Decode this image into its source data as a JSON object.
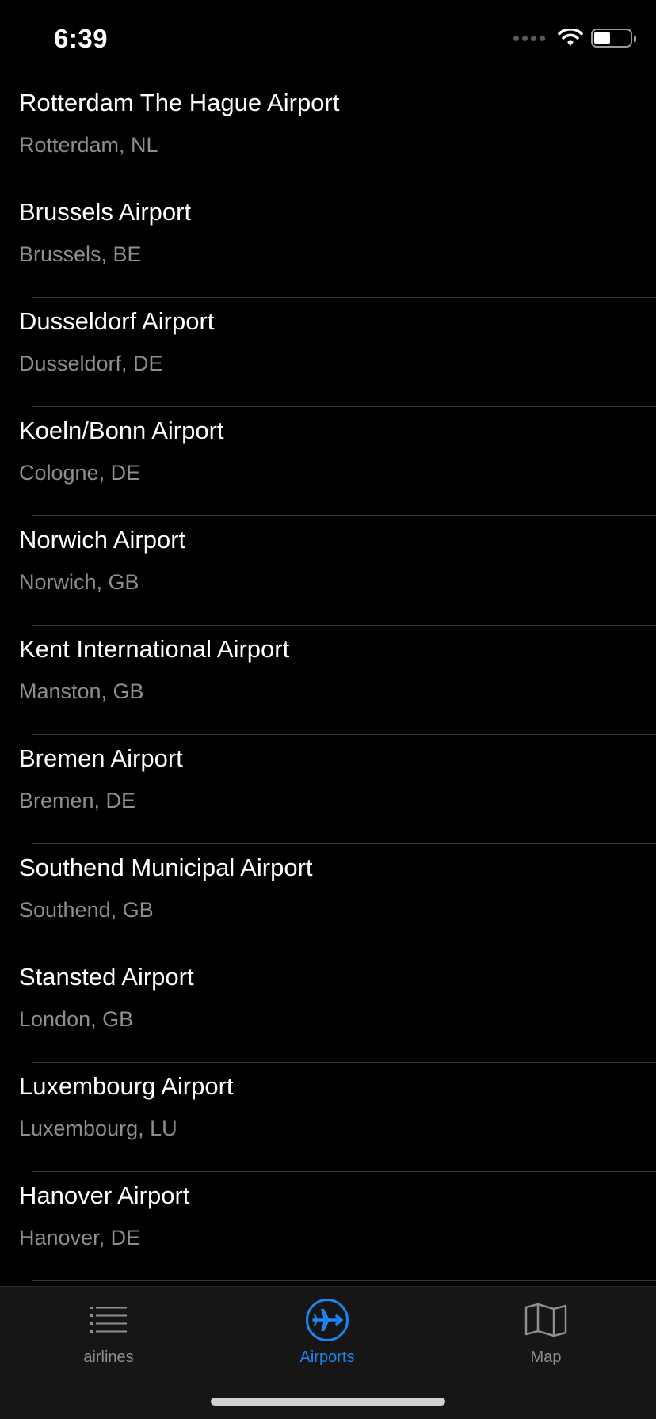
{
  "status": {
    "time": "6:39"
  },
  "airports": [
    {
      "name": "Rotterdam The Hague Airport",
      "location": "Rotterdam, NL"
    },
    {
      "name": "Brussels Airport",
      "location": "Brussels, BE"
    },
    {
      "name": "Dusseldorf Airport",
      "location": "Dusseldorf, DE"
    },
    {
      "name": "Koeln/Bonn Airport",
      "location": "Cologne, DE"
    },
    {
      "name": "Norwich Airport",
      "location": "Norwich, GB"
    },
    {
      "name": "Kent International Airport",
      "location": "Manston, GB"
    },
    {
      "name": "Bremen Airport",
      "location": "Bremen, DE"
    },
    {
      "name": "Southend Municipal Airport",
      "location": "Southend, GB"
    },
    {
      "name": "Stansted Airport",
      "location": "London, GB"
    },
    {
      "name": "Luxembourg Airport",
      "location": "Luxembourg, LU"
    },
    {
      "name": "Hanover Airport",
      "location": "Hanover, DE"
    }
  ],
  "tabs": [
    {
      "label": "airlines",
      "icon": "list-icon"
    },
    {
      "label": "Airports",
      "icon": "airplane-icon"
    },
    {
      "label": "Map",
      "icon": "map-icon"
    }
  ],
  "colors": {
    "accent": "#1f84f2",
    "secondary_text": "#8d8d92",
    "background": "#000000"
  }
}
